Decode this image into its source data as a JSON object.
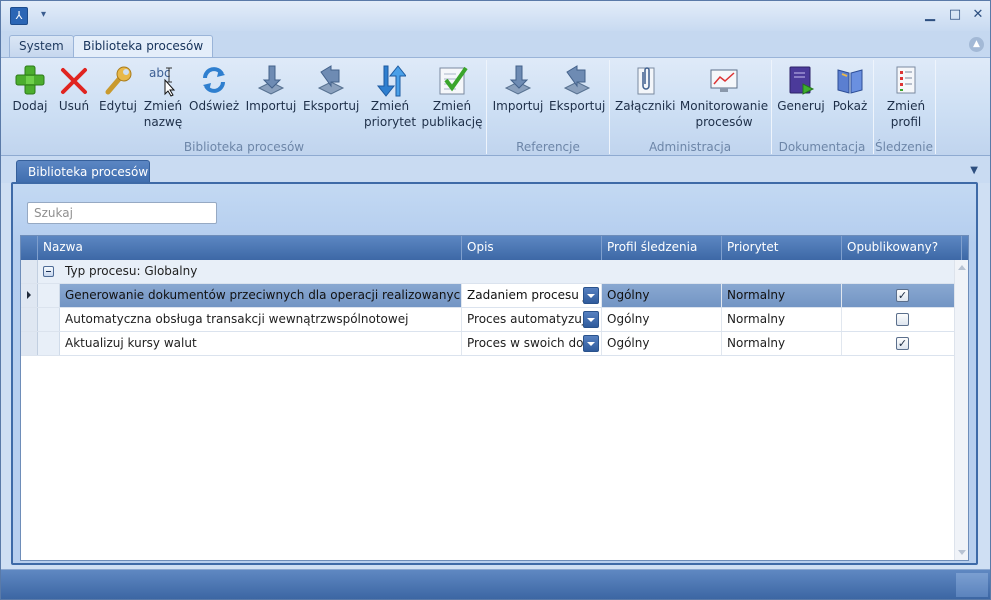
{
  "title_bar": {
    "app_icon": "process-app-icon",
    "window_buttons": {
      "minimize": "▁",
      "maximize": "□",
      "close": "✕"
    }
  },
  "ribbon_tabs": [
    {
      "label": "System"
    },
    {
      "label": "Biblioteka procesów",
      "active": true
    }
  ],
  "ribbon": {
    "groups": [
      {
        "label": "Biblioteka procesów"
      },
      {
        "label": "Referencje"
      },
      {
        "label": "Administracja"
      },
      {
        "label": "Dokumentacja"
      },
      {
        "label": "Śledzenie"
      }
    ],
    "buttons": {
      "add": {
        "line1": "Dodaj",
        "icon": "plus-icon"
      },
      "delete": {
        "line1": "Usuń",
        "icon": "x-icon"
      },
      "edit": {
        "line1": "Edytuj",
        "icon": "wrench-icon"
      },
      "rename": {
        "line1": "Zmień",
        "line2": "nazwę",
        "icon": "rename-abc-icon"
      },
      "refresh": {
        "line1": "Odśwież",
        "icon": "refresh-icon"
      },
      "import": {
        "line1": "Importuj",
        "icon": "import-icon"
      },
      "export": {
        "line1": "Eksportuj",
        "icon": "export-icon"
      },
      "priority": {
        "line1": "Zmień",
        "line2": "priorytet",
        "icon": "priority-arrows-icon"
      },
      "publication": {
        "line1": "Zmień",
        "line2": "publikację",
        "icon": "publish-check-icon"
      },
      "ref_import": {
        "line1": "Importuj",
        "icon": "import-icon"
      },
      "ref_export": {
        "line1": "Eksportuj",
        "icon": "export-icon"
      },
      "attachments": {
        "line1": "Załączniki",
        "icon": "paperclip-icon"
      },
      "monitoring": {
        "line1": "Monitorowanie",
        "line2": "procesów",
        "icon": "monitor-chart-icon"
      },
      "generate": {
        "line1": "Generuj",
        "icon": "generate-doc-icon"
      },
      "show": {
        "line1": "Pokaż",
        "icon": "book-icon"
      },
      "profile": {
        "line1": "Zmień",
        "line2": "profil",
        "icon": "profile-list-icon"
      }
    }
  },
  "doc_tab": {
    "label": "Biblioteka procesów"
  },
  "search": {
    "placeholder": "Szukaj"
  },
  "grid": {
    "columns": [
      "Nazwa",
      "Opis",
      "Profil śledzenia",
      "Priorytet",
      "Opublikowany?"
    ],
    "group_label": "Typ procesu: Globalny",
    "rows": [
      {
        "name": "Generowanie dokumentów przeciwnych dla operacji realizowanych pom…",
        "desc": "Zadaniem procesu jes",
        "profile": "Ogólny",
        "priority": "Normalny",
        "published": true,
        "selected": true
      },
      {
        "name": "Automatyczna obsługa transakcji wewnątrzwspólnotowej",
        "desc": "Proces automatyzuje",
        "profile": "Ogólny",
        "priority": "Normalny",
        "published": false,
        "selected": false
      },
      {
        "name": "Aktualizuj kursy walut",
        "desc": "Proces w swoich dom",
        "profile": "Ogólny",
        "priority": "Normalny",
        "published": true,
        "selected": false
      }
    ]
  },
  "colors": {
    "accent": "#3d68a6",
    "ribbon_bg": "#cddff4",
    "selected_row": "#7f9fcb"
  }
}
